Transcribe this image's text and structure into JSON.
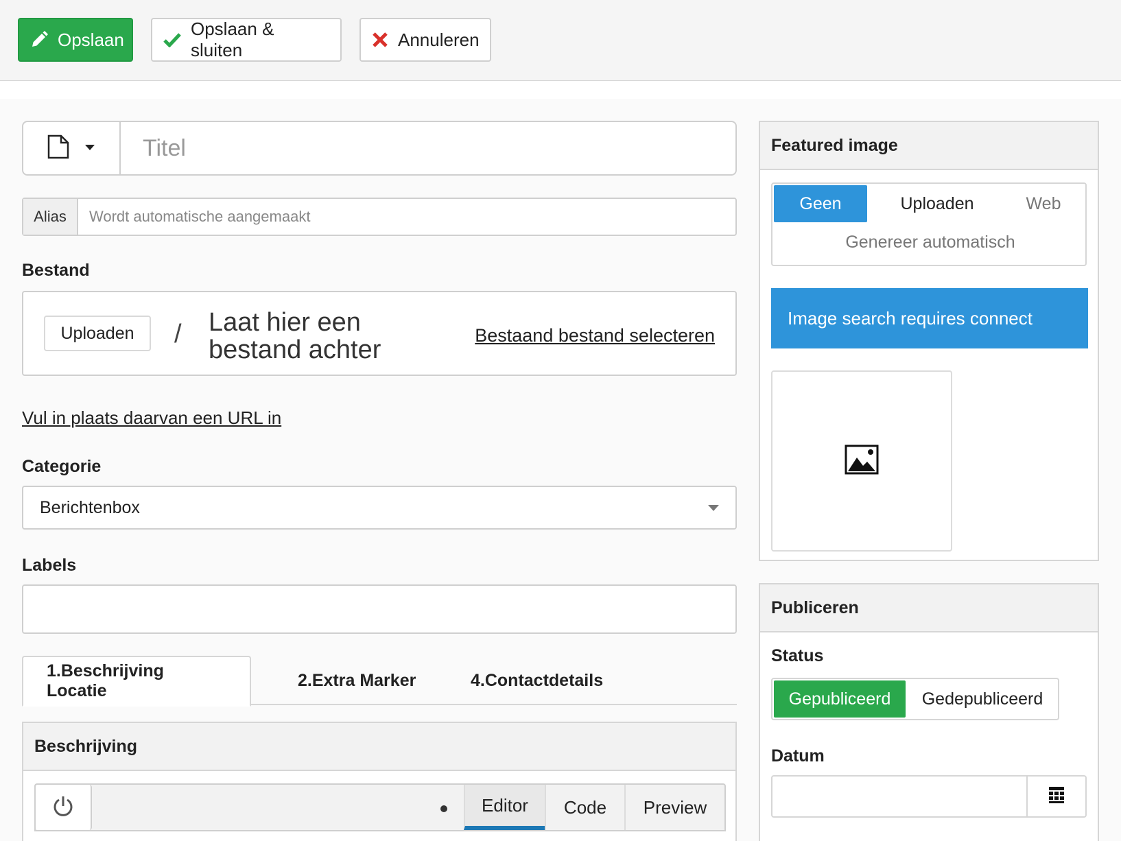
{
  "toolbar": {
    "save_label": "Opslaan",
    "save_close_label": "Opslaan & sluiten",
    "cancel_label": "Annuleren"
  },
  "form": {
    "title_placeholder": "Titel",
    "alias_label": "Alias",
    "alias_placeholder": "Wordt automatische aangemaakt",
    "file_label": "Bestand",
    "file_upload_label": "Uploaden",
    "file_separator": "/",
    "file_drop_text": "Laat hier een bestand achter",
    "file_existing_link": "Bestaand bestand selecteren",
    "url_link": "Vul in plaats daarvan een URL in",
    "category_label": "Categorie",
    "category_value": "Berichtenbox",
    "labels_label": "Labels"
  },
  "tabs": [
    {
      "label": "1.Beschrijving Locatie",
      "active": true
    },
    {
      "label": "2.Extra Marker",
      "active": false
    },
    {
      "label": "4.Contactdetails",
      "active": false
    }
  ],
  "description": {
    "heading": "Beschrijving",
    "editor_tabs": [
      "Editor",
      "Code",
      "Preview"
    ],
    "active_editor_tab": "Editor"
  },
  "featured_image": {
    "heading": "Featured image",
    "sources": [
      "Geen",
      "Uploaden",
      "Web",
      "Genereer automatisch"
    ],
    "selected_source": "Geen",
    "notice": "Image search requires connect",
    "icon": "image-icon"
  },
  "publish": {
    "heading": "Publiceren",
    "status_label": "Status",
    "status_options": [
      "Gepubliceerd",
      "Gedepubliceerd"
    ],
    "status_selected": "Gepubliceerd",
    "date_label": "Datum",
    "date_value": ""
  },
  "colors": {
    "success": "#2aa84c",
    "primary": "#2e94da",
    "danger": "#d9312b",
    "editor_accent": "#1c78b5"
  }
}
